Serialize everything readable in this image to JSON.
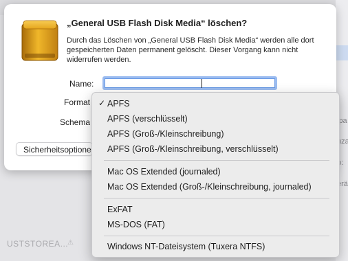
{
  "background": {
    "right_fragments": [
      "ipa",
      "nza",
      "p:",
      "erä"
    ],
    "bottom_item": "USTSTOREA...",
    "bottom_icon": "warning-icon"
  },
  "dialog": {
    "title": "„General USB Flash Disk Media“ löschen?",
    "message": "Durch das Löschen von „General USB Flash Disk Media“ werden alle dort gespeicherten Daten permanent gelöscht. Dieser Vorgang kann nicht widerrufen werden.",
    "icon": "external-drive-icon",
    "name_label": "Name:",
    "name_value": "",
    "format_label": "Format",
    "scheme_label": "Schema",
    "security_button": "Sicherheitsoptionen"
  },
  "menu": {
    "selected": "APFS",
    "check_mark": "✓",
    "items": [
      "APFS",
      "APFS (verschlüsselt)",
      "APFS (Groß-/Kleinschreibung)",
      "APFS (Groß-/Kleinschreibung, verschlüsselt)",
      "Mac OS Extended (journaled)",
      "Mac OS Extended (Groß-/Kleinschreibung, journaled)",
      "ExFAT",
      "MS-DOS (FAT)",
      "Windows NT-Dateisystem (Tuxera NTFS)"
    ]
  },
  "colors": {
    "accent": "#6b9be6",
    "drive_gold": "#e5a51d"
  }
}
